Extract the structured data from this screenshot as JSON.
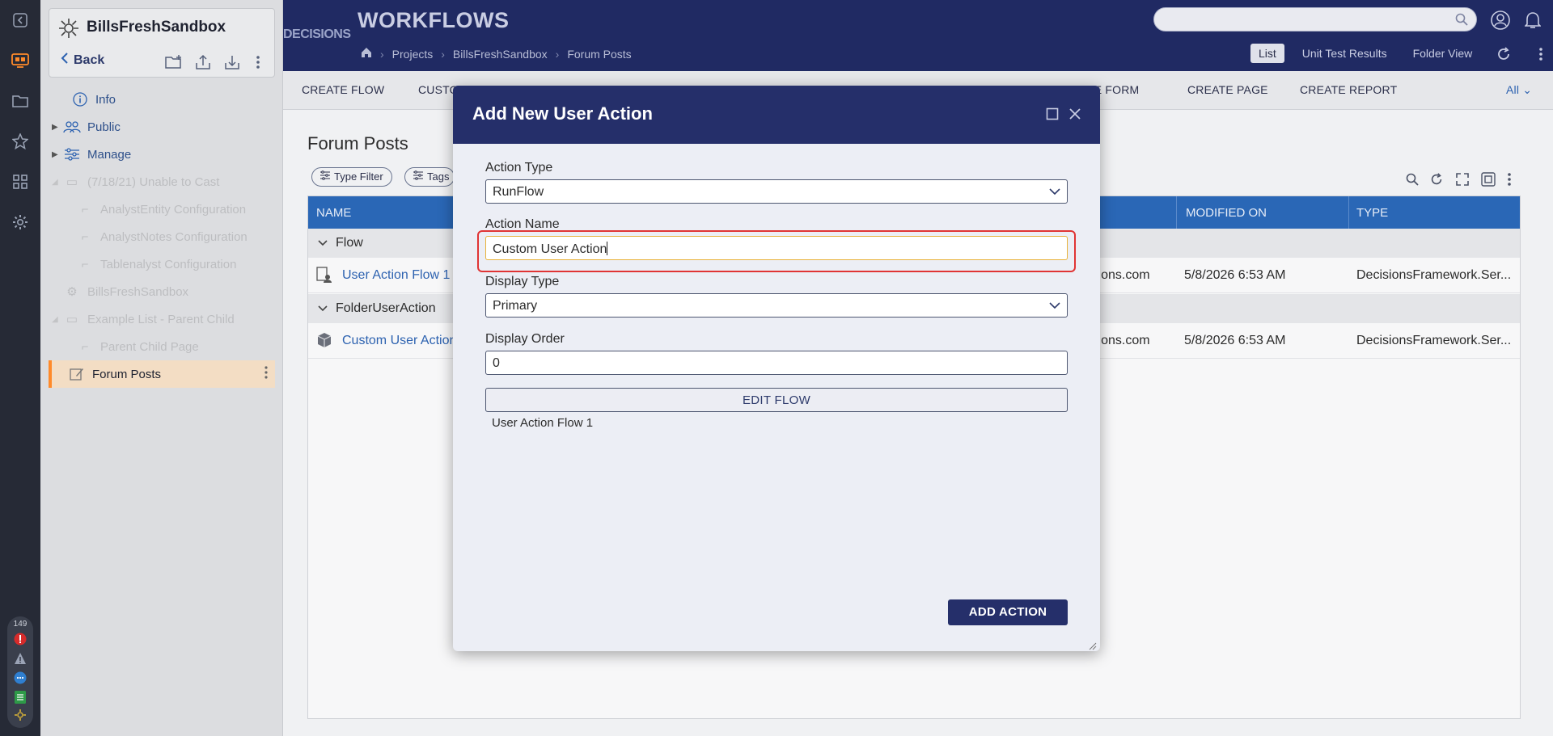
{
  "rail": {
    "notification_count": "149"
  },
  "sidebar": {
    "title": "BillsFreshSandbox",
    "back_label": "Back",
    "items": [
      {
        "label": "Info"
      },
      {
        "label": "Public"
      },
      {
        "label": "Manage"
      },
      {
        "label": "(7/18/21) Unable to Cast"
      },
      {
        "label": "AnalystEntity Configuration"
      },
      {
        "label": "AnalystNotes Configuration"
      },
      {
        "label": "Tablenalyst Configuration"
      },
      {
        "label": "BillsFreshSandbox"
      },
      {
        "label": "Example List - Parent Child"
      },
      {
        "label": "Parent Child Page"
      },
      {
        "label": "Forum Posts"
      }
    ]
  },
  "header": {
    "brand": "DECISIONS",
    "title": "WORKFLOWS",
    "breadcrumbs": [
      "Projects",
      "BillsFreshSandbox",
      "Forum Posts"
    ],
    "search_placeholder": "",
    "view_tabs": [
      "List",
      "Unit Test Results",
      "Folder View"
    ]
  },
  "actionbar": {
    "items": [
      "CREATE FLOW",
      "CUSTO",
      "TE FORM",
      "CREATE PAGE",
      "CREATE REPORT"
    ],
    "all_label": "All"
  },
  "main": {
    "title": "Forum Posts",
    "filters": [
      "Type Filter",
      "Tags"
    ],
    "columns": [
      "NAME",
      "MODIFIED ON",
      "TYPE"
    ],
    "groups": [
      {
        "name": "Flow",
        "rows": [
          {
            "name": "User Action Flow 1",
            "modified_by": "isions.com",
            "modified_on": "5/8/2026 6:53 AM",
            "type": "DecisionsFramework.Ser..."
          }
        ]
      },
      {
        "name": "FolderUserAction",
        "rows": [
          {
            "name": "Custom User Action",
            "modified_by": "isions.com",
            "modified_on": "5/8/2026 6:53 AM",
            "type": "DecisionsFramework.Ser..."
          }
        ]
      }
    ]
  },
  "dialog": {
    "title": "Add New User Action",
    "action_type_label": "Action Type",
    "action_type_value": "RunFlow",
    "action_name_label": "Action Name",
    "action_name_value": "Custom User Action",
    "display_type_label": "Display Type",
    "display_type_value": "Primary",
    "display_order_label": "Display Order",
    "display_order_value": "0",
    "edit_flow_label": "EDIT FLOW",
    "flow_name": "User Action Flow 1",
    "add_action_label": "ADD ACTION"
  },
  "colors": {
    "header_bg": "#202a63",
    "dialog_header_bg": "#252f6a",
    "grid_header_bg": "#2a67b6",
    "accent_orange": "#ff8a2a",
    "highlight_red": "#e03434"
  }
}
